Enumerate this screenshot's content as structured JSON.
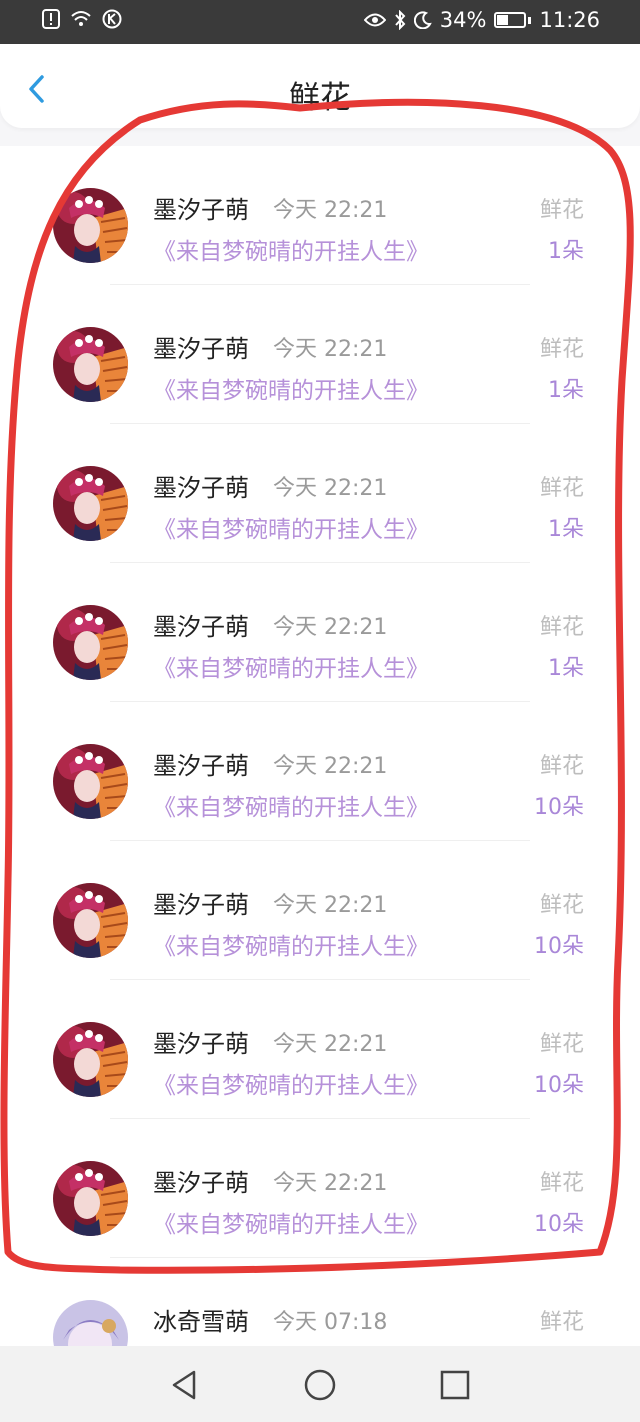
{
  "status_bar": {
    "battery": "34%",
    "time": "11:26",
    "icons": [
      "alert-icon",
      "wifi-icon",
      "k-icon",
      "eye-icon",
      "bluetooth-icon",
      "moon-icon",
      "battery-icon"
    ]
  },
  "header": {
    "title": "鲜花",
    "back_icon": "chevron-left-icon"
  },
  "colors": {
    "accent_blue": "#2f9be0",
    "purple": "#b691d9",
    "marker_red": "#e53935"
  },
  "list": [
    {
      "name": "墨汐子萌",
      "time": "今天 22:21",
      "book": "《来自梦碗晴的开挂人生》",
      "gift": "鲜花",
      "count": "1朵"
    },
    {
      "name": "墨汐子萌",
      "time": "今天 22:21",
      "book": "《来自梦碗晴的开挂人生》",
      "gift": "鲜花",
      "count": "1朵"
    },
    {
      "name": "墨汐子萌",
      "time": "今天 22:21",
      "book": "《来自梦碗晴的开挂人生》",
      "gift": "鲜花",
      "count": "1朵"
    },
    {
      "name": "墨汐子萌",
      "time": "今天 22:21",
      "book": "《来自梦碗晴的开挂人生》",
      "gift": "鲜花",
      "count": "1朵"
    },
    {
      "name": "墨汐子萌",
      "time": "今天 22:21",
      "book": "《来自梦碗晴的开挂人生》",
      "gift": "鲜花",
      "count": "10朵"
    },
    {
      "name": "墨汐子萌",
      "time": "今天 22:21",
      "book": "《来自梦碗晴的开挂人生》",
      "gift": "鲜花",
      "count": "10朵"
    },
    {
      "name": "墨汐子萌",
      "time": "今天 22:21",
      "book": "《来自梦碗晴的开挂人生》",
      "gift": "鲜花",
      "count": "10朵"
    },
    {
      "name": "墨汐子萌",
      "time": "今天 22:21",
      "book": "《来自梦碗晴的开挂人生》",
      "gift": "鲜花",
      "count": "10朵"
    },
    {
      "name": "冰奇雪萌",
      "time": "今天 07:18",
      "book": "",
      "gift": "鲜花",
      "count": ""
    }
  ],
  "nav_bar": {
    "icons": [
      "back-triangle-icon",
      "home-circle-icon",
      "recents-square-icon"
    ]
  }
}
